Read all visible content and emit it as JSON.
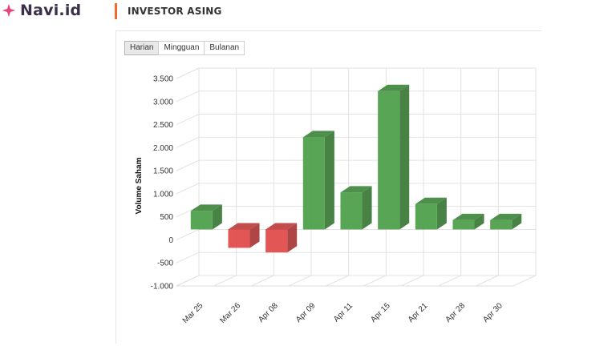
{
  "brand": {
    "name": "Navi.id",
    "icon": "sparkle-icon",
    "icon_color": "#e8447a"
  },
  "section": {
    "title": "INVESTOR ASING",
    "accent_color": "#f26a2e"
  },
  "tabs": [
    {
      "label": "Harian",
      "active": true
    },
    {
      "label": "Mingguan",
      "active": false
    },
    {
      "label": "Bulanan",
      "active": false
    }
  ],
  "colors": {
    "positive": "#4a9e46",
    "negative": "#e04848"
  },
  "chart_data": {
    "type": "bar",
    "title": "",
    "xlabel": "",
    "ylabel": "Volume Saham",
    "ylim": [
      -1000,
      3500
    ],
    "yticks": [
      -1000,
      -500,
      0,
      500,
      1000,
      1500,
      2000,
      2500,
      3000,
      3500
    ],
    "ytick_labels": [
      "-1.000",
      "-500",
      "0",
      "500",
      "1.000",
      "1.500",
      "2.000",
      "2.500",
      "3.000",
      "3.500"
    ],
    "grid": true,
    "style": "3d-columns",
    "categories": [
      "Mar 25",
      "Mar 26",
      "Apr 08",
      "Apr 09",
      "Apr 11",
      "Apr 15",
      "Apr 21",
      "Apr 28",
      "Apr 30"
    ],
    "values": [
      400,
      -400,
      -500,
      2000,
      800,
      3000,
      550,
      200,
      200
    ]
  }
}
